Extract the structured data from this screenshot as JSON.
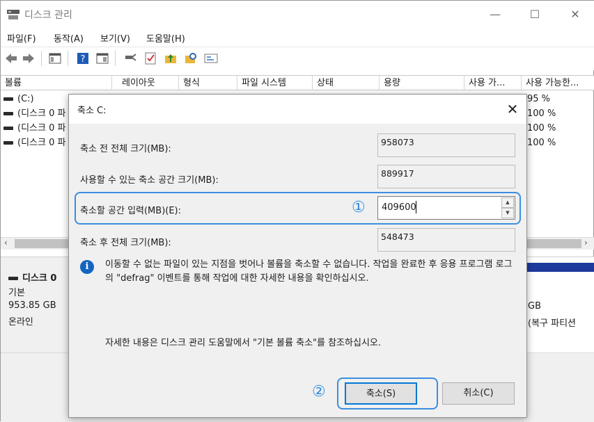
{
  "window": {
    "title": "디스크 관리"
  },
  "menu": [
    "파일(F)",
    "동작(A)",
    "보기(V)",
    "도움말(H)"
  ],
  "columns": [
    "볼륨",
    "레이아웃",
    "형식",
    "파일 시스템",
    "상태",
    "용량",
    "사용 가...",
    "사용 가능한..."
  ],
  "volumes": [
    {
      "name": "(C:)",
      "pct": "95 %"
    },
    {
      "name": "(디스크 0 파",
      "pct": "100 %"
    },
    {
      "name": "(디스크 0 파",
      "pct": "100 %"
    },
    {
      "name": "(디스크 0 파",
      "pct": "100 %"
    }
  ],
  "disk": {
    "name": "디스크 0",
    "type": "기본",
    "size": "953.85 GB",
    "status": "온라인"
  },
  "partition_right": {
    "size": "GB",
    "label": "(복구 파티션"
  },
  "dialog": {
    "title": "축소 C:",
    "total_before_label": "축소 전 전체 크기(MB):",
    "total_before_value": "958073",
    "available_label": "사용할 수 있는 축소 공간 크기(MB):",
    "available_value": "889917",
    "shrink_label": "축소할 공간 입력(MB)(E):",
    "shrink_value": "409600",
    "total_after_label": "축소 후 전체 크기(MB):",
    "total_after_value": "548473",
    "info_text": "이동할 수 없는 파일이 있는 지점을 벗어나 볼륨을 축소할 수 없습니다. 작업을 완료한 후 응용 프로그램 로그의 \"defrag\" 이벤트를 통해 작업에 대한 자세한 내용을 확인하십시오.",
    "help_text": "자세한 내용은 디스크 관리 도움말에서 \"기본 볼륨 축소\"를 참조하십시오.",
    "shrink_button": "축소(S)",
    "cancel_button": "취소(C)"
  },
  "annotations": {
    "step1": "①",
    "step2": "②"
  },
  "colors": {
    "highlight": "#3a8ee0",
    "partition_bar": "#1e3a9c",
    "info_icon": "#1565c0"
  }
}
